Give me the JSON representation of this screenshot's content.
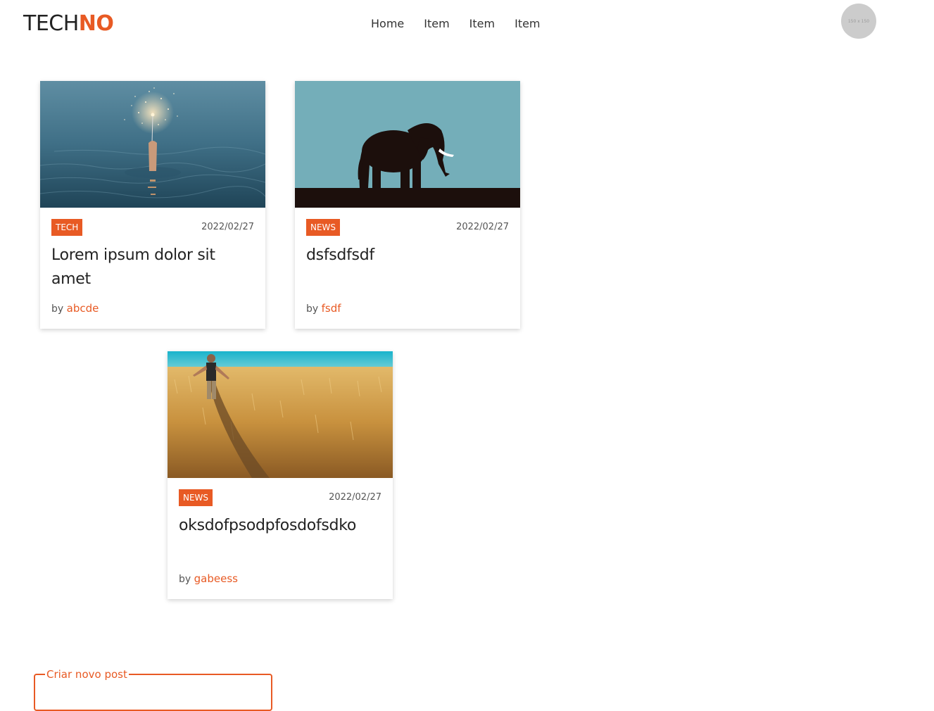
{
  "header": {
    "logo_part1": "TECH",
    "logo_part2": "NO",
    "nav": [
      "Home",
      "Item",
      "Item",
      "Item"
    ],
    "avatar_placeholder": "150 x 150"
  },
  "posts": [
    {
      "category": "TECH",
      "date": "2022/02/27",
      "title": "Lorem ipsum dolor sit amet",
      "by": "by",
      "author": "abcde",
      "image": "sparkler-in-water"
    },
    {
      "category": "NEWS",
      "date": "2022/02/27",
      "title": "dsfsdfsdf",
      "by": "by",
      "author": "fsdf",
      "image": "elephant-silhouette"
    },
    {
      "category": "NEWS",
      "date": "2022/02/27",
      "title": "oksdofpsodpfosdofsdko",
      "by": "by",
      "author": "gabeess",
      "image": "man-in-wheat-field"
    }
  ],
  "new_post": {
    "legend": "Criar novo post"
  },
  "colors": {
    "accent": "#e85a24",
    "text": "#222222",
    "muted": "#555555",
    "avatar_bg": "#cccccc"
  }
}
